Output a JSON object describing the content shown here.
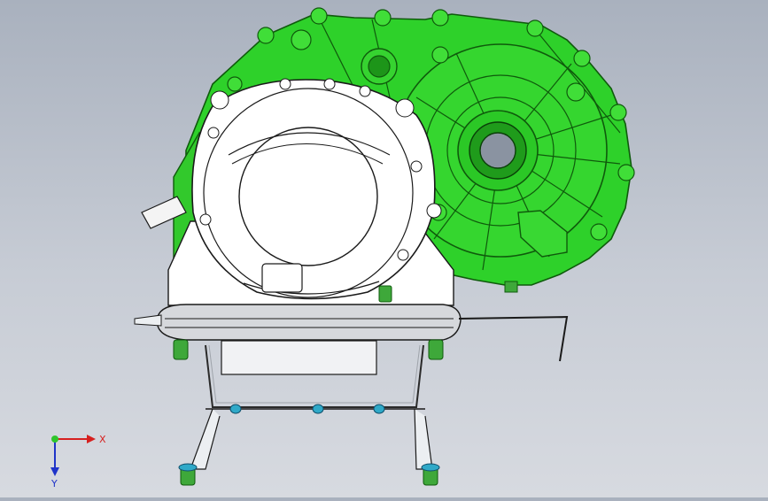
{
  "viewport": {
    "background_top": "#a9b1be",
    "background_bottom": "#d7dae0"
  },
  "model": {
    "housing_color": "#2ed12a",
    "housing_dark": "#0f5a0c",
    "motor_color": "#ffffff",
    "motor_outline": "#1a1a1a",
    "bracket_color": "#e9ecef",
    "fastener_color": "#3ea83a",
    "washer_color": "#2fa9c8"
  },
  "triad": {
    "x_label": "X",
    "y_label": "Y",
    "x_color": "#d6201f",
    "y_color": "#1f34c9",
    "origin_color": "#2ec52c"
  }
}
